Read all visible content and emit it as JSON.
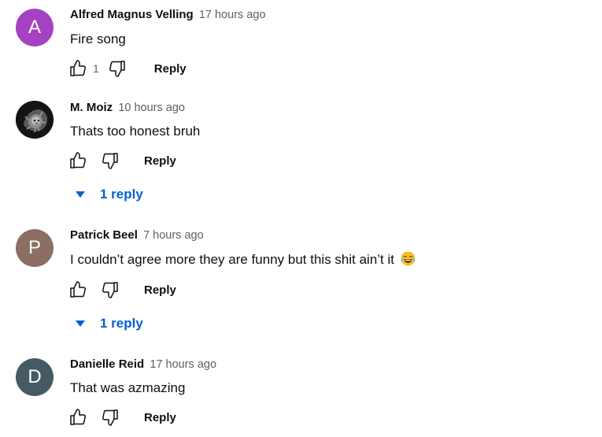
{
  "comments": [
    {
      "avatar_letter": "A",
      "avatar_color": "#a542c2",
      "author": "Alfred Magnus Velling",
      "time": "17 hours ago",
      "text": "Fire song",
      "like_count": "1",
      "reply_label": "Reply"
    },
    {
      "avatar_letter": "",
      "avatar_color": "#151515",
      "author": "M. Moiz",
      "time": "10 hours ago",
      "text": "Thats too honest bruh",
      "reply_label": "Reply",
      "replies_label": "1 reply"
    },
    {
      "avatar_letter": "P",
      "avatar_color": "#8d6e63",
      "author": "Patrick Beel",
      "time": "7 hours ago",
      "text": "I couldn’t agree more they are funny but this shit ain’t it",
      "emoji": "face-with-tears-of-joy",
      "reply_label": "Reply",
      "replies_label": "1 reply"
    },
    {
      "avatar_letter": "D",
      "avatar_color": "#455a64",
      "author": "Danielle Reid",
      "time": "17 hours ago",
      "text": "That was azmazing",
      "reply_label": "Reply"
    }
  ],
  "colors": {
    "reply_link": "#065fd4",
    "secondary_text": "#606060"
  }
}
